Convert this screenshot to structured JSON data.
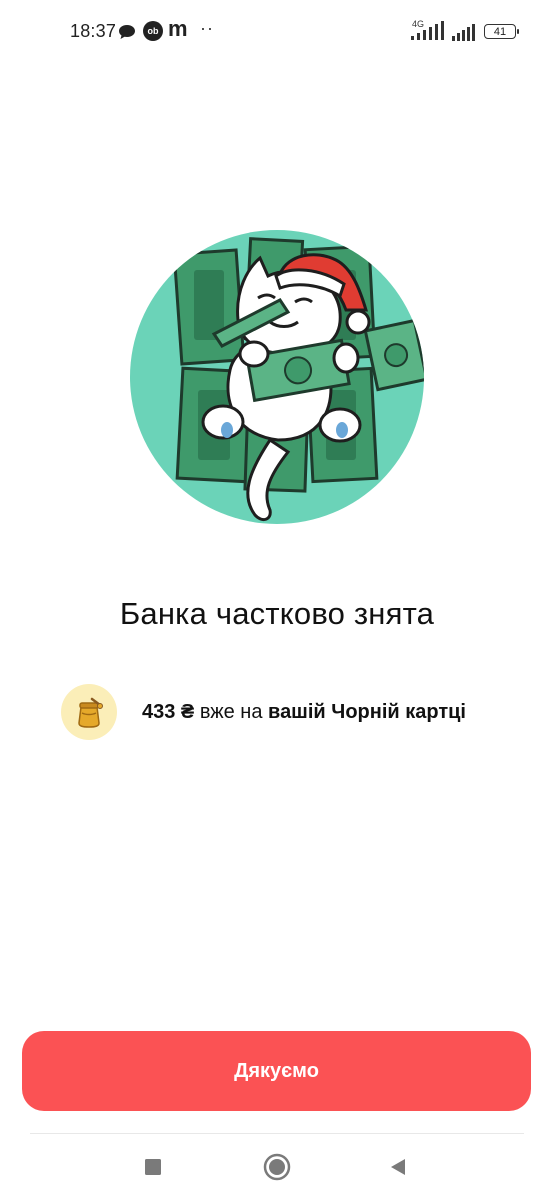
{
  "status_bar": {
    "time": "18:37",
    "network_label": "4G",
    "battery": "41",
    "m_label": "m",
    "dots": "··",
    "ob_label": "ob",
    "icons": [
      "chat-bubble-icon",
      "ob-app-icon",
      "m-app-icon",
      "more-dots-icon",
      "signal-4g-icon",
      "signal-icon",
      "battery-icon"
    ]
  },
  "screen": {
    "title": "Банка частково знята",
    "amount": "433 ₴",
    "text_middle": "вже на",
    "card_name": "вашій Чорній картці",
    "avatar_icon": "honey-jar-icon",
    "illustration": "cat-with-money-illustration"
  },
  "actions": {
    "thanks_label": "Дякуємо"
  },
  "nav": {
    "items": [
      "recent-apps-square-icon",
      "home-circle-icon",
      "back-triangle-icon"
    ]
  },
  "colors": {
    "button": "#fb5254",
    "hero_circle": "#6bd3b8",
    "avatar_bg": "#fbeeb8"
  }
}
